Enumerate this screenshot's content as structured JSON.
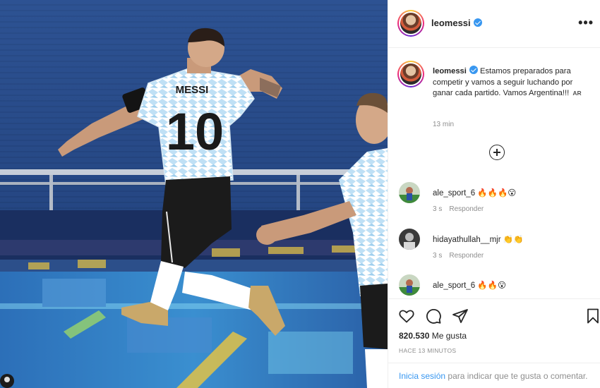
{
  "post": {
    "author": "leomessi",
    "caption": "Estamos preparados para competir y vamos a seguir luchando por ganar cada partido. Vamos Argentina!!!",
    "caption_tag": "AR",
    "posted_ago": "13 min"
  },
  "photo": {
    "jersey_name": "MESSI",
    "jersey_number": "10"
  },
  "comments": [
    {
      "username": "ale_sport_6",
      "text": "🔥🔥🔥😮",
      "time": "3 s",
      "reply_label": "Responder"
    },
    {
      "username": "hidayathullah__mjr",
      "text": "👏👏",
      "time": "3 s",
      "reply_label": "Responder"
    },
    {
      "username": "ale_sport_6",
      "text": "🔥🔥😮",
      "time": "",
      "reply_label": ""
    }
  ],
  "engagement": {
    "likes_count": "820.530",
    "likes_label": "Me gusta",
    "timestamp": "HACE 13 MINUTOS"
  },
  "login_prompt": {
    "link_label": "Inicia sesión",
    "rest": "para indicar que te gusta o comentar."
  },
  "icons": {
    "more": "more-options-icon",
    "add_comments": "plus-circle-icon",
    "like": "heart-icon",
    "comment": "comment-icon",
    "share": "share-icon",
    "save": "bookmark-icon"
  },
  "colors": {
    "link": "#3897f0",
    "verified": "#3897f0",
    "text": "#262626",
    "muted": "#8e8e8e"
  }
}
